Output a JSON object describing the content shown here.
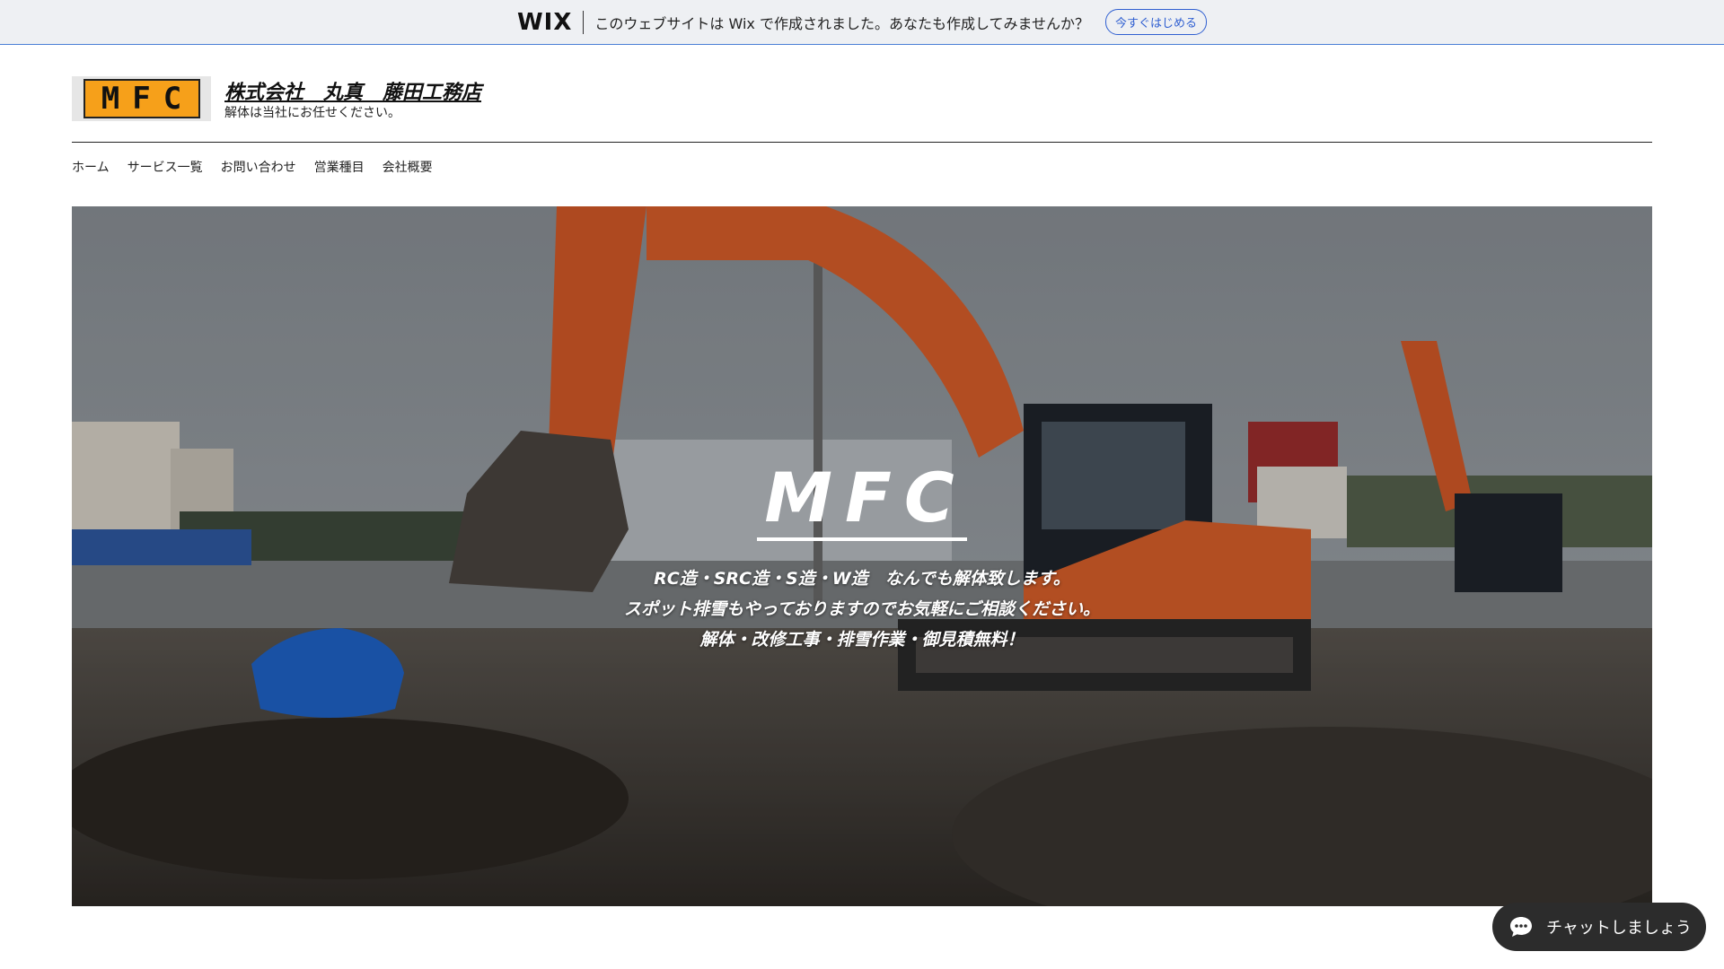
{
  "wix_banner": {
    "logo": "WIX",
    "message": "このウェブサイトは Wix で作成されました。あなたも作成してみませんか？",
    "cta": "今すぐはじめる"
  },
  "header": {
    "logo_text": "MFC",
    "title": "株式会社　丸真　藤田工務店",
    "tagline": "解体は当社にお任せください。"
  },
  "nav": {
    "items": [
      {
        "label": "ホーム"
      },
      {
        "label": "サービス一覧"
      },
      {
        "label": "お問い合わせ"
      },
      {
        "label": "営業種目"
      },
      {
        "label": "会社概要"
      }
    ]
  },
  "hero": {
    "title": "MFC",
    "lines": [
      "RC造・SRC造・S造・W造　なんでも解体致します。",
      "スポット排雪もやっておりますのでお気軽にご相談ください。",
      "解体・改修工事・排雪作業・御見積無料！"
    ]
  },
  "chat": {
    "label": "チャットしましょう"
  },
  "colors": {
    "logo_orange": "#f6a01a",
    "wix_accent": "#2f5fd1",
    "excavator_orange": "#e0622a"
  }
}
